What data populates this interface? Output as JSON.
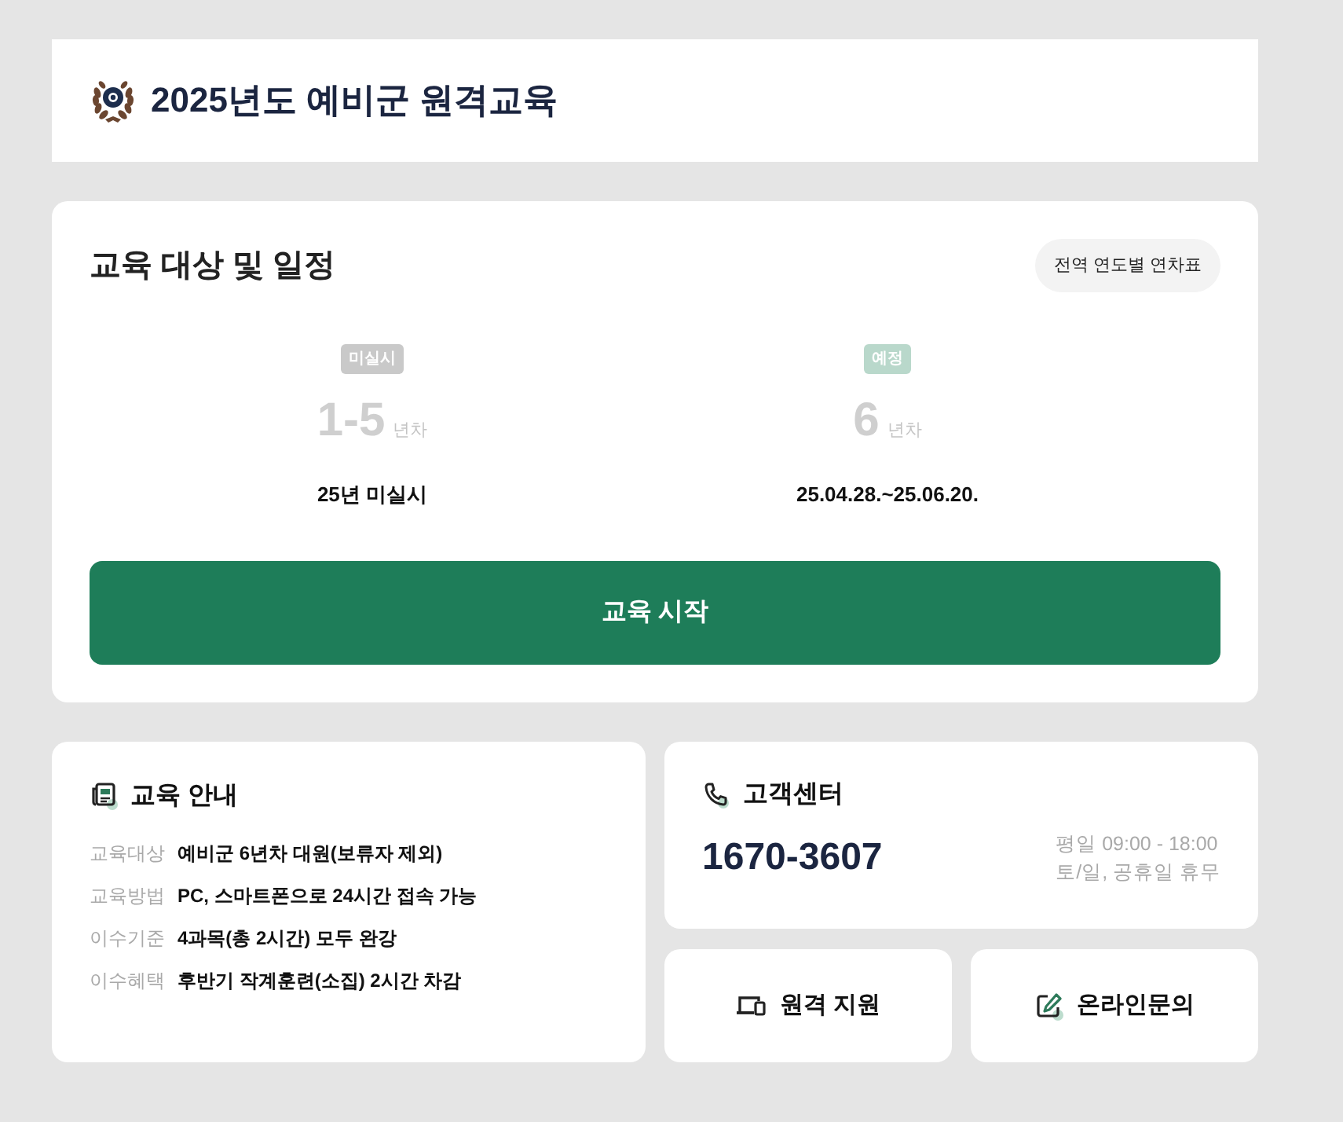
{
  "header": {
    "title": "2025년도 예비군 원격교육"
  },
  "schedule": {
    "title": "교육 대상 및 일정",
    "chart_button": "전역 연도별 연차표",
    "items": [
      {
        "kind": "missed",
        "badge": "미실시",
        "years": "1-5",
        "unit": "년차",
        "detail": "25년 미실시"
      },
      {
        "kind": "planned",
        "badge": "예정",
        "years": "6",
        "unit": "년차",
        "detail": "25.04.28.~25.06.20."
      }
    ],
    "start_button": "교육 시작"
  },
  "guide": {
    "title": "교육 안내",
    "rows": [
      {
        "label": "교육대상",
        "value": "예비군 6년차 대원(보류자 제외)"
      },
      {
        "label": "교육방법",
        "value": "PC, 스마트폰으로 24시간 접속 가능"
      },
      {
        "label": "이수기준",
        "value": "4과목(총 2시간) 모두 완강"
      },
      {
        "label": "이수혜택",
        "value": "후반기 작계훈련(소집) 2시간 차감"
      }
    ]
  },
  "support": {
    "title": "고객센터",
    "phone": "1670-3607",
    "hours": [
      "평일 09:00 - 18:00",
      "토/일, 공휴일 휴무"
    ]
  },
  "actions": [
    {
      "kind": "remote",
      "label": "원격 지원"
    },
    {
      "kind": "inquiry",
      "label": "온라인문의"
    }
  ]
}
